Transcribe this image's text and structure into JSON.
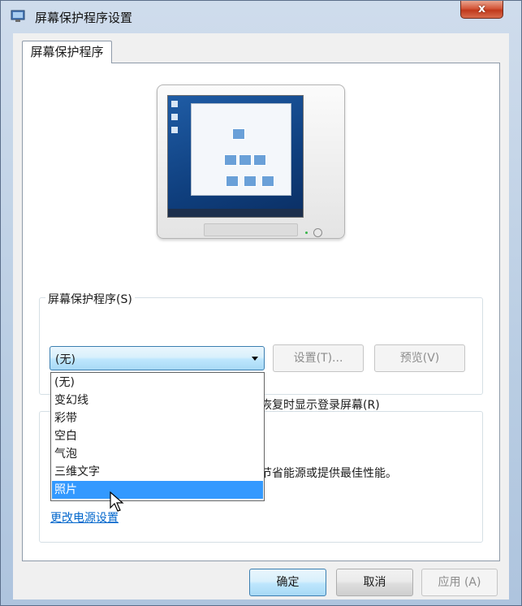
{
  "window": {
    "title": "屏幕保护程序设置",
    "close_label": "x"
  },
  "tabs": [
    {
      "label": "屏幕保护程序",
      "active": true
    }
  ],
  "screensaver_group": {
    "label": "屏幕保护程序(S)",
    "combo_value": "(无)",
    "settings_button": "设置(T)...",
    "preview_button": "预览(V)",
    "resume_text_visible": "恢复时显示登录屏幕(R)"
  },
  "power_group": {
    "text_visible": "节省能源或提供最佳性能。",
    "link": "更改电源设置"
  },
  "dropdown": {
    "options": [
      "(无)",
      "变幻线",
      "彩带",
      "空白",
      "气泡",
      "三维文字",
      "照片"
    ],
    "highlighted": "照片"
  },
  "footer": {
    "ok_label": "确定",
    "cancel_label": "取消",
    "apply_label": "应用 (A)"
  },
  "colors": {
    "selection": "#3399ff",
    "link": "#0066cc",
    "close_button": "#c8432a"
  }
}
